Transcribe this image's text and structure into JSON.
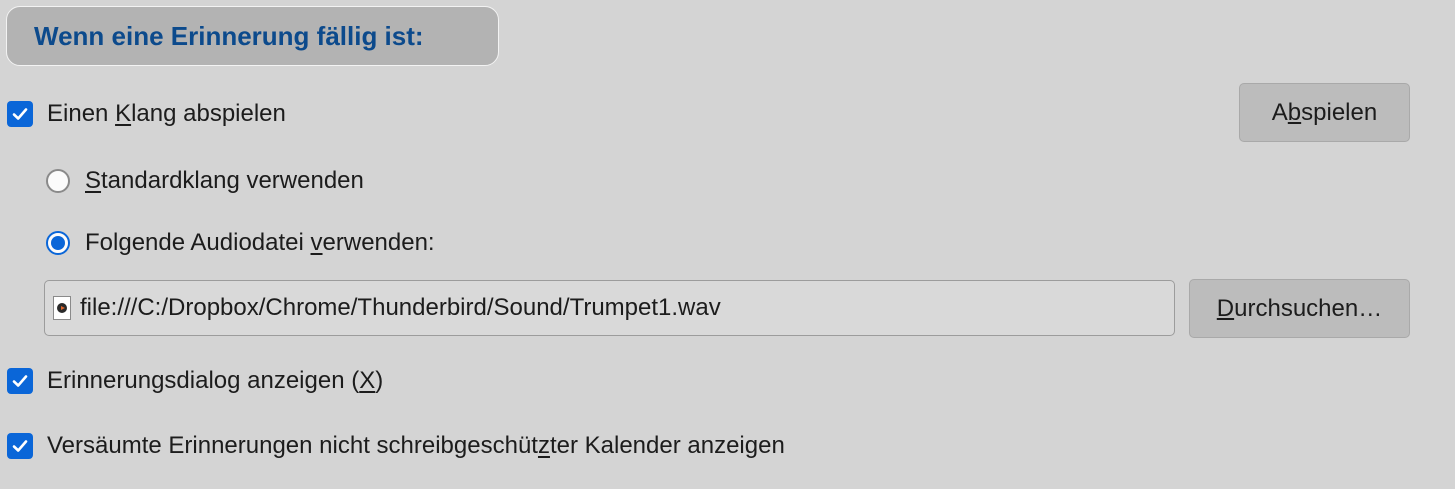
{
  "section": {
    "title": "Wenn eine Erinnerung fällig ist:"
  },
  "play_sound": {
    "checked": true,
    "label_pre": "Einen ",
    "label_key": "K",
    "label_post": "lang abspielen"
  },
  "play_button": {
    "pre": "A",
    "key": "b",
    "post": "spielen"
  },
  "default_sound": {
    "selected": false,
    "key": "S",
    "post": "tandardklang verwenden"
  },
  "custom_sound": {
    "selected": true,
    "pre": "Folgende Audiodatei ",
    "key": "v",
    "post": "erwenden:"
  },
  "file_path": {
    "value": "file:///C:/Dropbox/Chrome/Thunderbird/Sound/Trumpet1.wav",
    "icon": "audio-file-icon"
  },
  "browse_button": {
    "key": "D",
    "post": "urchsuchen…"
  },
  "show_dialog": {
    "checked": true,
    "pre": "Erinnerungsdialog anzeigen (",
    "key": "X",
    "post": ")"
  },
  "show_missed": {
    "checked": true,
    "pre": "Versäumte Erinnerungen nicht schreibgeschüt",
    "key": "z",
    "post": "ter Kalender anzeigen"
  },
  "colors": {
    "accent": "#0a66d8",
    "header_text": "#0c4a8c",
    "background": "#d4d4d4"
  }
}
